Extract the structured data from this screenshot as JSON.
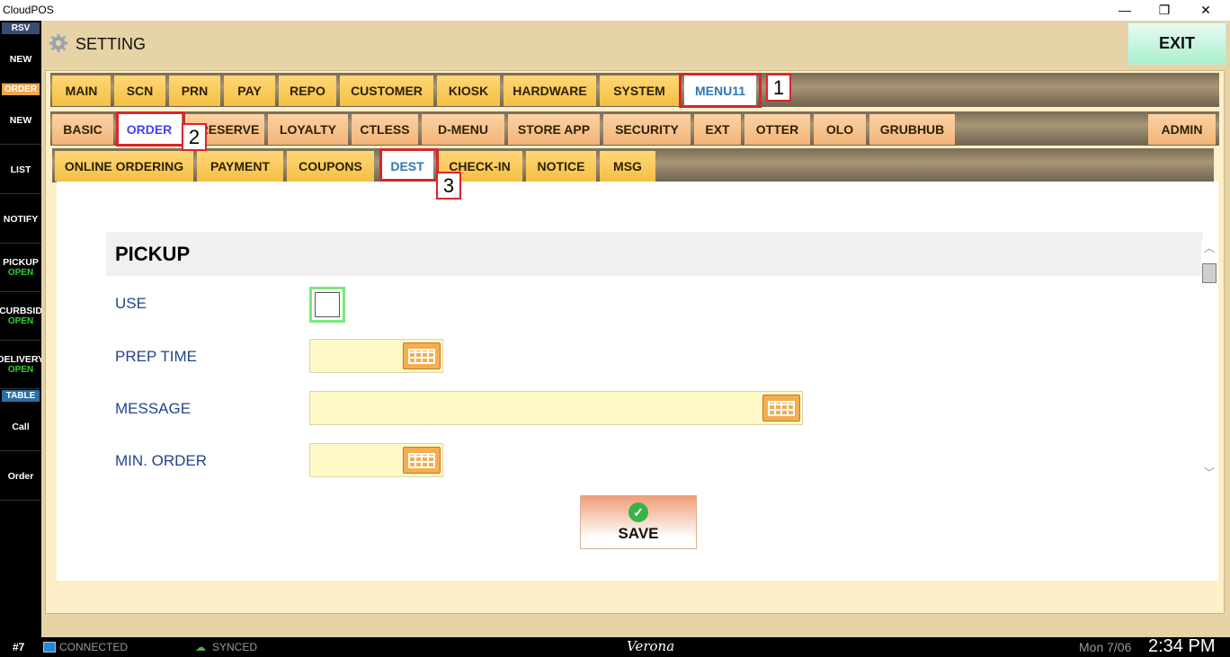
{
  "window": {
    "title": "CloudPOS",
    "minimize": "—",
    "restore": "❐",
    "close": "✕"
  },
  "sidebar": {
    "rsv_tag": "RSV",
    "order_tag": "ORDER",
    "table_tag": "TABLE",
    "items": [
      {
        "label": "NEW",
        "status": ""
      },
      {
        "label": "NEW",
        "status": ""
      },
      {
        "label": "LIST",
        "status": ""
      },
      {
        "label": "NOTIFY",
        "status": ""
      },
      {
        "label": "PICKUP",
        "status": "OPEN"
      },
      {
        "label": "CURBSID",
        "status": "OPEN"
      },
      {
        "label": "DELIVERY",
        "status": "OPEN"
      },
      {
        "label": "Call",
        "status": ""
      },
      {
        "label": "Order",
        "status": ""
      }
    ]
  },
  "header": {
    "title": "SETTING",
    "exit_label": "EXIT"
  },
  "tabs_main": [
    "MAIN",
    "SCN",
    "PRN",
    "PAY",
    "REPO",
    "CUSTOMER",
    "KIOSK",
    "HARDWARE",
    "SYSTEM",
    "MENU11"
  ],
  "tabs_sub": [
    "BASIC",
    "ORDER",
    "RESERVE",
    "LOYALTY",
    "CTLESS",
    "D-MENU",
    "STORE APP",
    "SECURITY",
    "EXT",
    "OTTER",
    "OLO",
    "GRUBHUB",
    "ADMIN"
  ],
  "tabs_order": [
    "ONLINE ORDERING",
    "PAYMENT",
    "COUPONS",
    "DEST",
    "CHECK-IN",
    "NOTICE",
    "MSG"
  ],
  "callouts": [
    "1",
    "2",
    "3"
  ],
  "form": {
    "section_title": "PICKUP",
    "fields": [
      {
        "label": "USE",
        "type": "checkbox",
        "checked": false
      },
      {
        "label": "PREP TIME",
        "value": ""
      },
      {
        "label": "MESSAGE",
        "value": ""
      },
      {
        "label": "MIN. ORDER",
        "value": ""
      }
    ],
    "save_label": "SAVE"
  },
  "statusbar": {
    "terminal": "#7",
    "connection": "CONNECTED",
    "sync": "SYNCED",
    "store": "Verona",
    "date": "Mon 7/06",
    "time": "2:34 PM"
  },
  "colors": {
    "accent_tab": "#f4bf44",
    "active_tab_text": "#2c78b6",
    "callout": "#d9252d",
    "status_open": "#2fd12f"
  }
}
